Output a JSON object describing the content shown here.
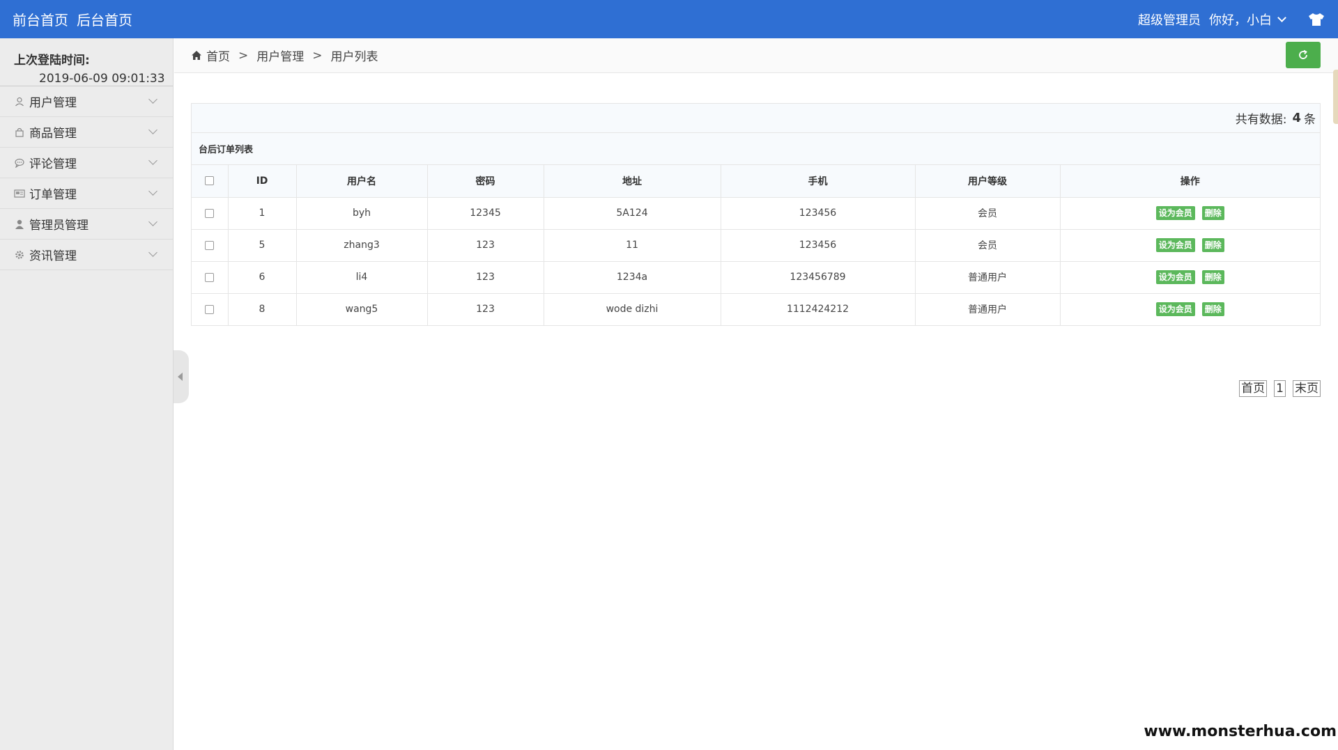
{
  "topbar": {
    "links": [
      "前台首页",
      "后台首页"
    ],
    "role": "超级管理员",
    "greeting": "你好，小白"
  },
  "sidebar": {
    "login_title": "上次登陆时间:",
    "login_time": "2019-06-09 09:01:33",
    "items": [
      {
        "label": "用户管理",
        "icon": "user-icon"
      },
      {
        "label": "商品管理",
        "icon": "bag-icon"
      },
      {
        "label": "评论管理",
        "icon": "comment-icon"
      },
      {
        "label": "订单管理",
        "icon": "card-icon"
      },
      {
        "label": "管理员管理",
        "icon": "admin-icon"
      },
      {
        "label": "资讯管理",
        "icon": "gear-icon"
      }
    ]
  },
  "breadcrumb": [
    "首页",
    "用户管理",
    "用户列表"
  ],
  "summary": {
    "label": "共有数据:",
    "count": "4",
    "unit": "条"
  },
  "table": {
    "title": "台后订单列表",
    "headers": [
      "ID",
      "用户名",
      "密码",
      "地址",
      "手机",
      "用户等级",
      "操作"
    ],
    "rows": [
      {
        "id": "1",
        "username": "byh",
        "password": "12345",
        "address": "5A124",
        "phone": "123456",
        "level": "会员"
      },
      {
        "id": "5",
        "username": "zhang3",
        "password": "123",
        "address": "11",
        "phone": "123456",
        "level": "会员"
      },
      {
        "id": "6",
        "username": "li4",
        "password": "123",
        "address": "1234a",
        "phone": "123456789",
        "level": "普通用户"
      },
      {
        "id": "8",
        "username": "wang5",
        "password": "123",
        "address": "wode dizhi",
        "phone": "1112424212",
        "level": "普通用户"
      }
    ],
    "action_set_member": "设为会员",
    "action_delete": "删除"
  },
  "pager": {
    "first": "首页",
    "current": "1",
    "last": "末页"
  },
  "watermark": "www.monsterhua.com",
  "colors": {
    "topbar": "#2f6fd3",
    "action_green": "#5cb85c"
  }
}
